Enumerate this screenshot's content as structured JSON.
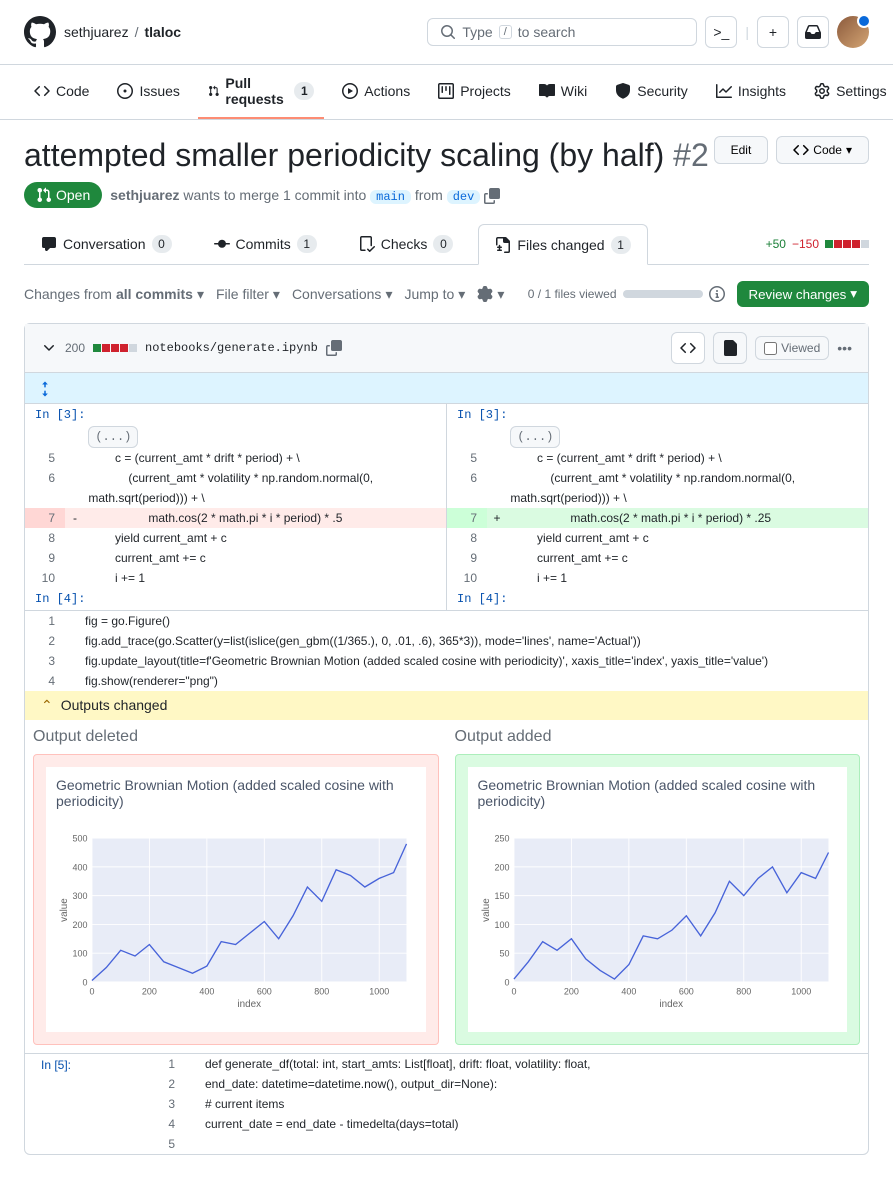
{
  "breadcrumb": {
    "owner": "sethjuarez",
    "repo": "tlaloc"
  },
  "search": {
    "placeholder": "Type",
    "hint": "to search",
    "key": "/"
  },
  "nav": {
    "code": "Code",
    "issues": "Issues",
    "pulls": "Pull requests",
    "pulls_count": "1",
    "actions": "Actions",
    "projects": "Projects",
    "wiki": "Wiki",
    "security": "Security",
    "insights": "Insights",
    "settings": "Settings"
  },
  "pr": {
    "title": "attempted smaller periodicity scaling (by half)",
    "number": "#2",
    "edit_btn": "Edit",
    "code_btn": "Code",
    "state": "Open",
    "author": "sethjuarez",
    "merge_text": "wants to merge 1 commit into",
    "base": "main",
    "from": "from",
    "head": "dev"
  },
  "subtabs": {
    "conversation": "Conversation",
    "conversation_count": "0",
    "commits": "Commits",
    "commits_count": "1",
    "checks": "Checks",
    "checks_count": "0",
    "files": "Files changed",
    "files_count": "1",
    "additions": "+50",
    "deletions": "−150"
  },
  "toolbar": {
    "changes_from": "Changes from",
    "all_commits": "all commits",
    "file_filter": "File filter",
    "conversations": "Conversations",
    "jump_to": "Jump to",
    "viewed_progress": "0 / 1 files viewed",
    "review": "Review changes"
  },
  "file": {
    "lines": "200",
    "path": "notebooks/generate.ipynb",
    "viewed": "Viewed"
  },
  "cells": {
    "in3": "In [3]:",
    "in4": "In [4]:",
    "in5": "In [5]:",
    "fold": "(...)"
  },
  "diff_lines": {
    "l5": "            c = (current_amt * drift * period) + \\",
    "l6": "                (current_amt * volatility * np.random.normal(0,",
    "l6b": "    math.sqrt(period))) + \\",
    "l7_del": "                math.cos(2 * math.pi * i * period) * .5",
    "l7_add": "                math.cos(2 * math.pi * i * period) * .25",
    "l8": "            yield current_amt + c",
    "l9": "            current_amt += c",
    "l10": "            i += 1"
  },
  "in4_code": {
    "l1": "fig = go.Figure()",
    "l2": "fig.add_trace(go.Scatter(y=list(islice(gen_gbm((1/365.), 0, .01, .6), 365*3)), mode='lines', name='Actual'))",
    "l3": "fig.update_layout(title=f'Geometric Brownian Motion (added scaled cosine with periodicity)', xaxis_title='index', yaxis_title='value')",
    "l4": "fig.show(renderer=\"png\")"
  },
  "outputs": {
    "banner": "Outputs changed",
    "deleted": "Output deleted",
    "added": "Output added"
  },
  "chart_data": [
    {
      "type": "line",
      "title": "Geometric Brownian Motion (added scaled cosine with periodicity)",
      "xlabel": "index",
      "ylabel": "value",
      "xlim": [
        0,
        1095
      ],
      "ylim": [
        0,
        500
      ],
      "x_ticks": [
        0,
        200,
        400,
        600,
        800,
        1000
      ],
      "y_ticks": [
        0,
        100,
        200,
        300,
        400,
        500
      ],
      "series": [
        {
          "name": "Actual",
          "color": "#4763d9",
          "x": [
            0,
            50,
            100,
            150,
            200,
            250,
            300,
            350,
            400,
            450,
            500,
            550,
            600,
            650,
            700,
            750,
            800,
            850,
            900,
            950,
            1000,
            1050,
            1095
          ],
          "y": [
            5,
            50,
            110,
            90,
            130,
            70,
            50,
            30,
            55,
            140,
            130,
            170,
            210,
            150,
            230,
            330,
            280,
            390,
            370,
            330,
            360,
            380,
            480
          ]
        }
      ]
    },
    {
      "type": "line",
      "title": "Geometric Brownian Motion (added scaled cosine with periodicity)",
      "xlabel": "index",
      "ylabel": "value",
      "xlim": [
        0,
        1095
      ],
      "ylim": [
        0,
        250
      ],
      "x_ticks": [
        0,
        200,
        400,
        600,
        800,
        1000
      ],
      "y_ticks": [
        0,
        50,
        100,
        150,
        200,
        250
      ],
      "series": [
        {
          "name": "Actual",
          "color": "#4763d9",
          "x": [
            0,
            50,
            100,
            150,
            200,
            250,
            300,
            350,
            400,
            450,
            500,
            550,
            600,
            650,
            700,
            750,
            800,
            850,
            900,
            950,
            1000,
            1050,
            1095
          ],
          "y": [
            5,
            35,
            70,
            55,
            75,
            40,
            20,
            5,
            30,
            80,
            75,
            90,
            115,
            80,
            120,
            175,
            150,
            180,
            200,
            155,
            190,
            180,
            225
          ]
        }
      ]
    }
  ],
  "in5_code": {
    "l1": "def generate_df(total: int, start_amts: List[float], drift: float, volatility: float,",
    "l2": "                end_date: datetime=datetime.now(), output_dir=None):",
    "l3": "    # current items",
    "l4": "    current_date = end_date - timedelta(days=total)",
    "l5": ""
  }
}
